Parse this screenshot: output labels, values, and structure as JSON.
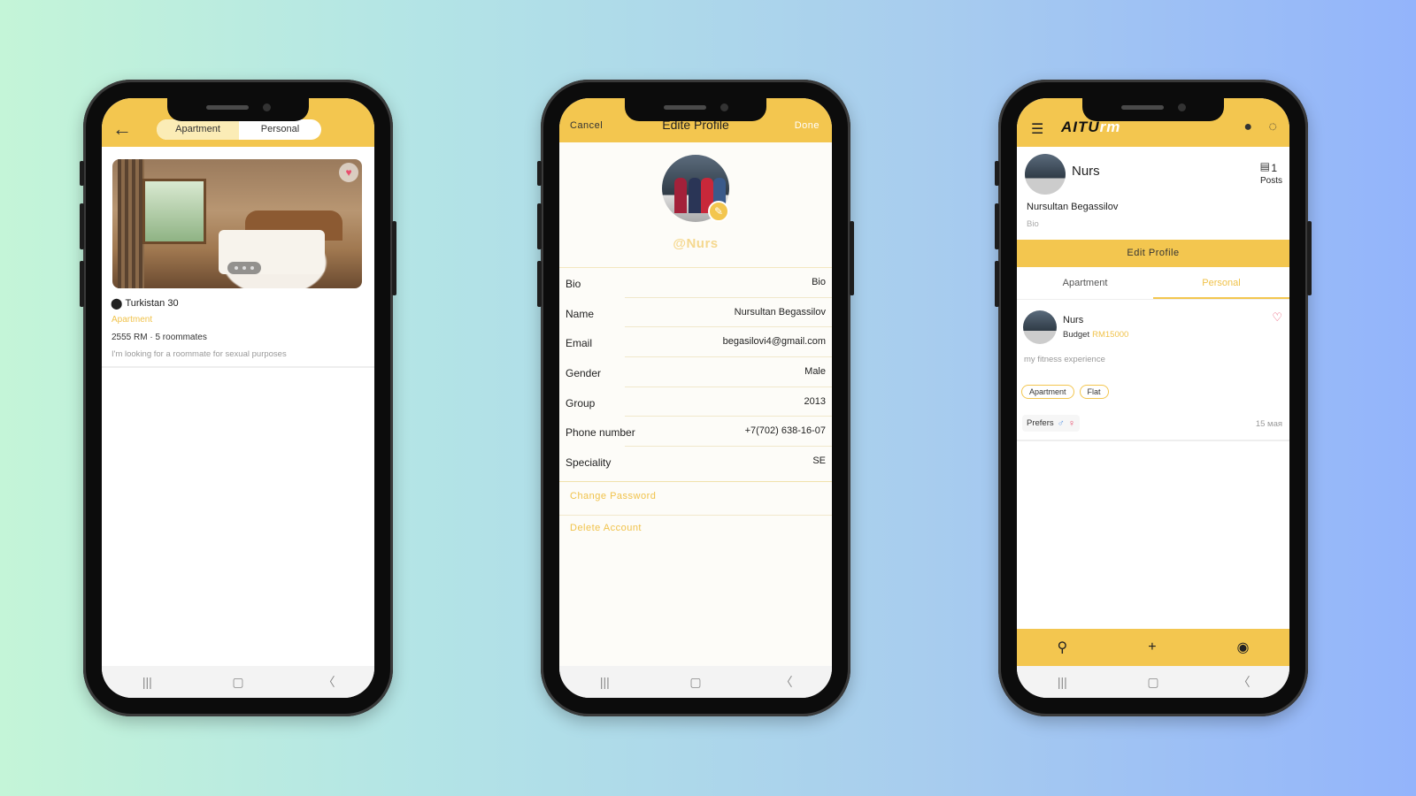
{
  "theme": {
    "accent": "#f3c64f",
    "accent_text": "#f0c24a",
    "like": "#e84d6c"
  },
  "sysnav": {
    "recents": "|||",
    "home": "▢",
    "back": "〈"
  },
  "phone1": {
    "back_icon": "arrow-left-icon",
    "toggle": {
      "apartment": "Apartment",
      "personal": "Personal",
      "selected": "Apartment"
    },
    "listing": {
      "location": "Turkistan 30",
      "type": "Apartment",
      "meta": "2555 RM · 5 roommates",
      "description": "I'm looking for a roommate for sexual purposes",
      "favorited": true
    }
  },
  "phone2": {
    "header": {
      "cancel": "Cancel",
      "title": "Edite Profile",
      "done": "Done"
    },
    "username": "@Nurs",
    "fields": [
      {
        "label": "Bio",
        "value": "Bio"
      },
      {
        "label": "Name",
        "value": "Nursultan Begassilov"
      },
      {
        "label": "Email",
        "value": "begasilovi4@gmail.com"
      },
      {
        "label": "Gender",
        "value": "Male"
      },
      {
        "label": "Group",
        "value": "2013"
      },
      {
        "label": "Phone number",
        "value": "+7(702) 638-16-07"
      },
      {
        "label": "Speciality",
        "value": "SE"
      }
    ],
    "change_password": "Change Password",
    "delete_account": "Delete Account"
  },
  "phone3": {
    "logo_main": "AITU",
    "logo_accent": "rm",
    "profile": {
      "name": "Nurs",
      "posts_count": "1",
      "posts_label": "Posts",
      "full_name": "Nursultan Begassilov",
      "bio": "Bio",
      "edit_button": "Edit Profile"
    },
    "tabs": {
      "apartment": "Apartment",
      "personal": "Personal",
      "selected": "Personal"
    },
    "post": {
      "name": "Nurs",
      "budget_label": "Budget",
      "budget_value": "RM15000",
      "description": "my fitness experience",
      "chips": [
        "Apartment",
        "Flat"
      ],
      "prefers": "Prefers",
      "date": "15 мая"
    }
  }
}
